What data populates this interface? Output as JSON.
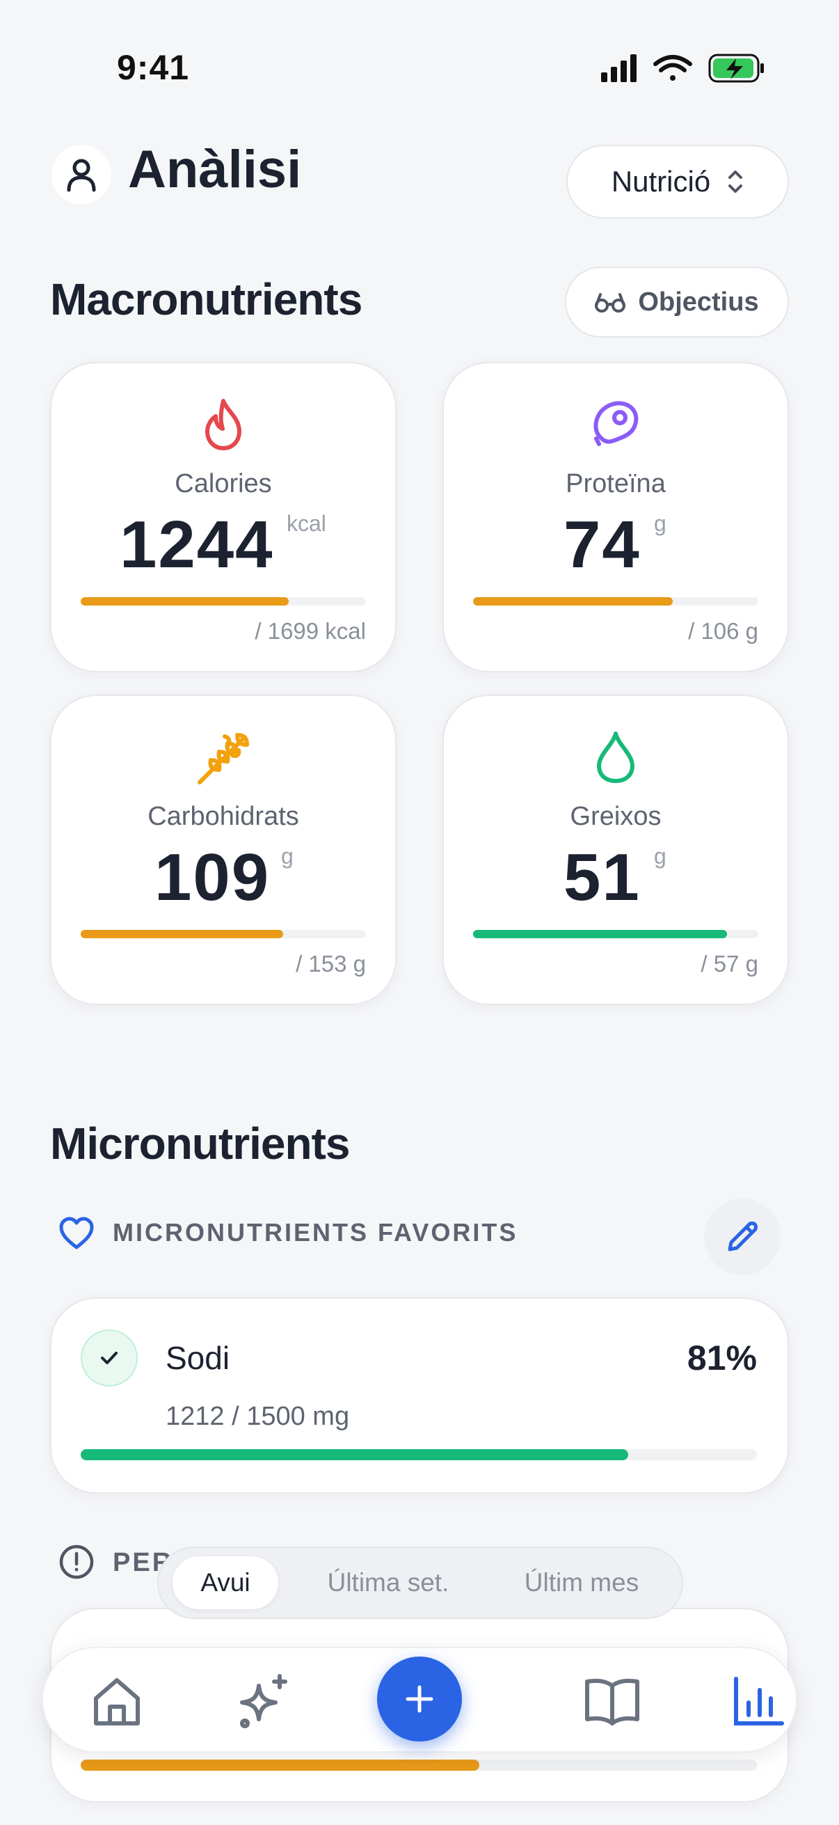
{
  "status_bar": {
    "time": "9:41"
  },
  "header": {
    "title": "Anàlisi",
    "selector_label": "Nutrició"
  },
  "macros": {
    "section_title": "Macronutrients",
    "goals_button": "Objectius",
    "items": [
      {
        "label": "Calories",
        "value": "1244",
        "unit": "kcal",
        "goal": "/ 1699 kcal",
        "progress": 0.73,
        "color": "#e89a18",
        "icon": "flame-icon",
        "icon_color": "#e5484d"
      },
      {
        "label": "Proteïna",
        "value": "74",
        "unit": "g",
        "goal": "/ 106 g",
        "progress": 0.7,
        "color": "#e89a18",
        "icon": "meat-icon",
        "icon_color": "#8b5cf6"
      },
      {
        "label": "Carbohidrats",
        "value": "109",
        "unit": "g",
        "goal": "/ 153 g",
        "progress": 0.71,
        "color": "#e89a18",
        "icon": "wheat-icon",
        "icon_color": "#f2a20c"
      },
      {
        "label": "Greixos",
        "value": "51",
        "unit": "g",
        "goal": "/ 57 g",
        "progress": 0.89,
        "color": "#17b978",
        "icon": "droplet-icon",
        "icon_color": "#17b978"
      }
    ]
  },
  "micros": {
    "section_title": "Micronutrients",
    "favorites_label": "MICRONUTRIENTS FAVORITS",
    "items": [
      {
        "name": "Sodi",
        "percent": "81%",
        "amount": "1212 / 1500 mg",
        "progress": 0.81,
        "color": "#17b978"
      }
    ],
    "second_section_label": "PER",
    "hidden_item_progress": 0.59
  },
  "period_selector": {
    "options": [
      "Avui",
      "Última set.",
      "Últim mes"
    ],
    "selected": "Avui"
  },
  "tabbar": {
    "items": [
      "home-icon",
      "sparkles-icon",
      "add-icon",
      "book-icon",
      "chart-icon"
    ],
    "active": "chart-icon",
    "accent": "#2a63e4"
  }
}
